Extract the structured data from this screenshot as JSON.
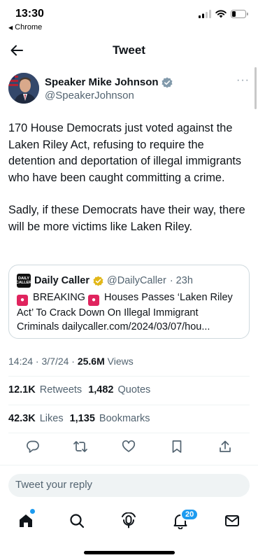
{
  "status": {
    "time": "13:30",
    "back_app": "Chrome"
  },
  "nav": {
    "title": "Tweet"
  },
  "author": {
    "name": "Speaker Mike Johnson",
    "handle": "@SpeakerJohnson",
    "verified_color": "#829aab"
  },
  "tweet": {
    "paragraphs": [
      "170 House Democrats just voted against the Laken Riley Act, refusing to require the detention and deportation of illegal immigrants who have been caught committing a crime.",
      "Sadly, if these Democrats have their way, there will be more victims like Laken Riley."
    ]
  },
  "quote": {
    "logo_line1": "DAILY",
    "logo_line2": "CALLER",
    "name": "Daily Caller",
    "handle": "@DailyCaller",
    "time": "· 23h",
    "line1_a": " BREAKING ",
    "line1_b": " Houses Passes ‘Laken Riley",
    "line2": "Act’ To Crack Down On Illegal Immigrant",
    "line3": "Criminals dailycaller.com/2024/03/07/hou..."
  },
  "meta": {
    "datetime": "14:24 · 3/7/24 · ",
    "views_count": "25.6M",
    "views_label": " Views"
  },
  "stats": {
    "retweets_count": "12.1K",
    "retweets_label": "Retweets",
    "quotes_count": "1,482",
    "quotes_label": "Quotes",
    "likes_count": "42.3K",
    "likes_label": "Likes",
    "bookmarks_count": "1,135",
    "bookmarks_label": "Bookmarks"
  },
  "reply": {
    "placeholder": "Tweet your reply"
  },
  "tabbar": {
    "notifications_badge": "20"
  },
  "colors": {
    "accent": "#1d9bf0",
    "muted": "#536471",
    "gold": "#e2b719"
  }
}
